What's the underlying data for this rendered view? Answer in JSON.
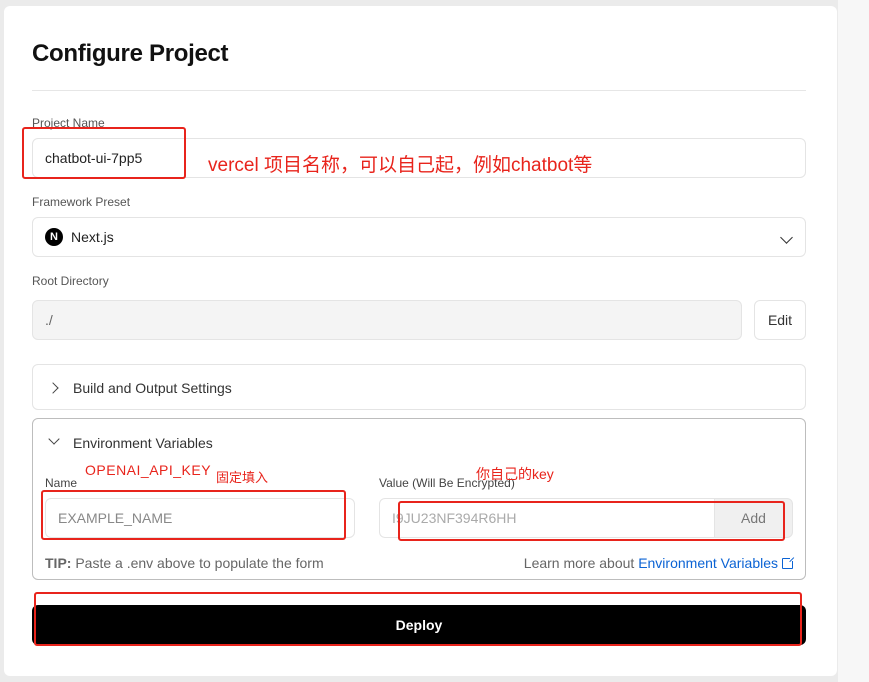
{
  "page": {
    "title": "Configure Project"
  },
  "project_name": {
    "label": "Project Name",
    "value": "chatbot-ui-7pp5"
  },
  "framework": {
    "label": "Framework Preset",
    "logo_letter": "N",
    "value": "Next.js"
  },
  "root_directory": {
    "label": "Root Directory",
    "value": "./",
    "edit_label": "Edit"
  },
  "build_settings": {
    "label": "Build and Output Settings"
  },
  "env": {
    "label": "Environment Variables",
    "name_label": "Name",
    "name_placeholder": "EXAMPLE_NAME",
    "value_label": "Value (Will Be Encrypted)",
    "value_placeholder": "I9JU23NF394R6HH",
    "add_label": "Add",
    "tip_prefix": "TIP:",
    "tip_text": " Paste a .env above to populate the form",
    "learn_text": "Learn more about ",
    "learn_link": "Environment Variables"
  },
  "deploy": {
    "label": "Deploy"
  },
  "annotations": {
    "project_note": "vercel 项目名称，可以自己起，例如chatbot等",
    "key_name": "OPENAI_API_KEY",
    "fixed_fill": "固定填入",
    "your_key": "你自己的key",
    "color": "#e8241c"
  }
}
